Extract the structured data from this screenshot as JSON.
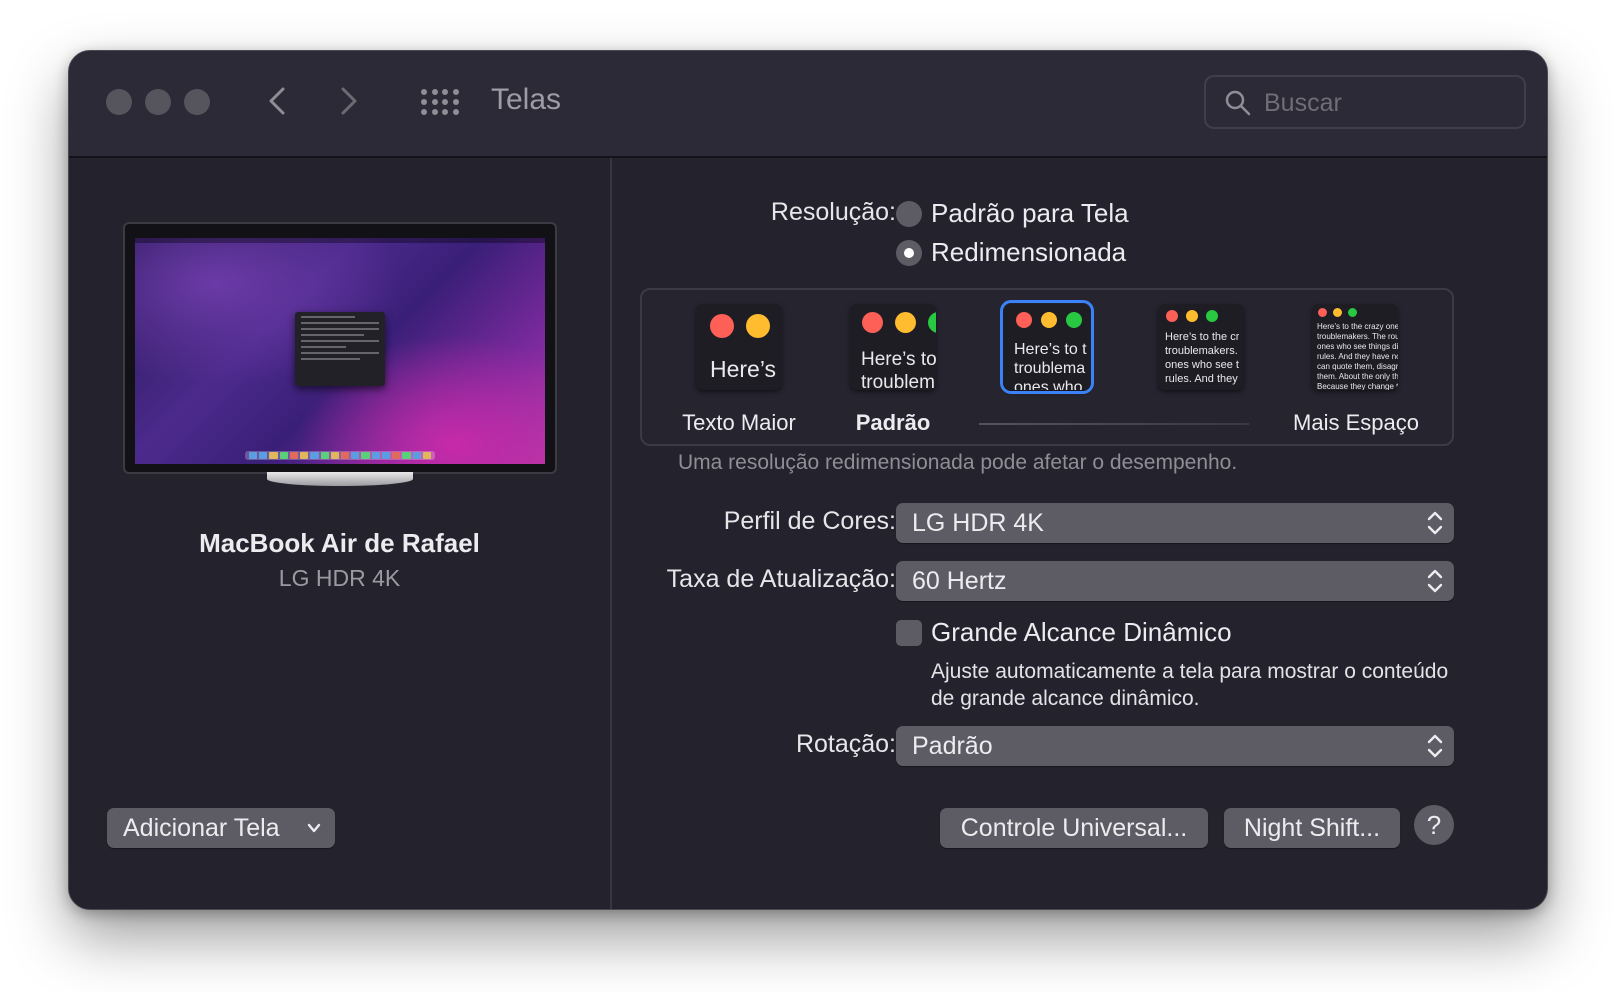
{
  "window": {
    "title": "Telas",
    "search_placeholder": "Buscar"
  },
  "sidebar": {
    "device_name": "MacBook Air de Rafael",
    "device_model": "LG HDR 4K",
    "add_screen_label": "Adicionar Tela"
  },
  "resolution": {
    "label": "Resolução:",
    "option_default": "Padrão para Tela",
    "option_scaled": "Redimensionada",
    "selected": "Redimensionada",
    "thumbnails": [
      {
        "text": "Here’s"
      },
      {
        "text": "Here’s to\ntroublem"
      },
      {
        "text": "Here’s to t\ntroublema\nones who"
      },
      {
        "text": "Here’s to the cr\ntroublemakers.\nones who see t\nrules. And they"
      },
      {
        "text": "Here’s to the crazy one\ntroublemakers. The rou\nones who see things dif\nrules. And they have no\ncan quote them, disagr\nthem. About the only th\nBecause they change th"
      }
    ],
    "label_larger": "Texto Maior",
    "label_default": "Padrão",
    "label_more_space": "Mais Espaço",
    "selected_index": 2,
    "note": "Uma resolução redimensionada pode afetar o desempenho."
  },
  "color_profile": {
    "label": "Perfil de Cores:",
    "value": "LG HDR 4K"
  },
  "refresh_rate": {
    "label": "Taxa de Atualização:",
    "value": "60 Hertz"
  },
  "hdr": {
    "label": "Grande Alcance Dinâmico",
    "description": "Ajuste automaticamente a tela para mostrar o conteúdo de grande alcance dinâmico.",
    "checked": false
  },
  "rotation": {
    "label": "Rotação:",
    "value": "Padrão"
  },
  "footer": {
    "universal_control": "Controle Universal...",
    "night_shift": "Night Shift...",
    "help": "?"
  },
  "colors": {
    "window_bg": "#24222d",
    "titlebar_bg": "#2c2a36",
    "control_bg": "#5d5b64",
    "accent": "#3b82f6",
    "traffic_red": "#fe5f57",
    "traffic_yellow": "#febc2e",
    "traffic_green": "#28c840"
  }
}
